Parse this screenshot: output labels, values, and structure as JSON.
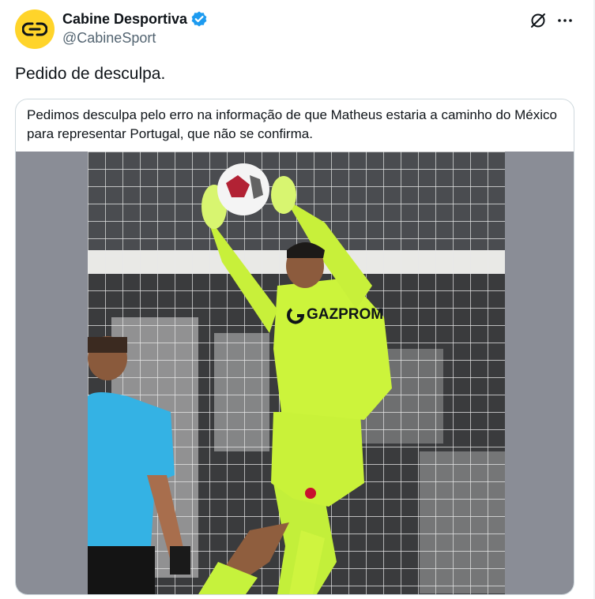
{
  "author": {
    "display_name": "Cabine Desportiva",
    "handle": "@CabineSport",
    "avatar_color": "#ffd42a",
    "verified_color": "#1d9bf0"
  },
  "tweet": {
    "text": "Pedido de desculpa."
  },
  "quoted_card": {
    "text": "Pedimos desculpa pelo erro na informação de que Matheus estaria a caminho do México para representar Portugal, que não se confirma.",
    "media_sponsor_text": "GAZPROM"
  },
  "icons": {
    "grok": "grok-icon",
    "more": "more-icon",
    "verified": "verified-badge-icon"
  }
}
